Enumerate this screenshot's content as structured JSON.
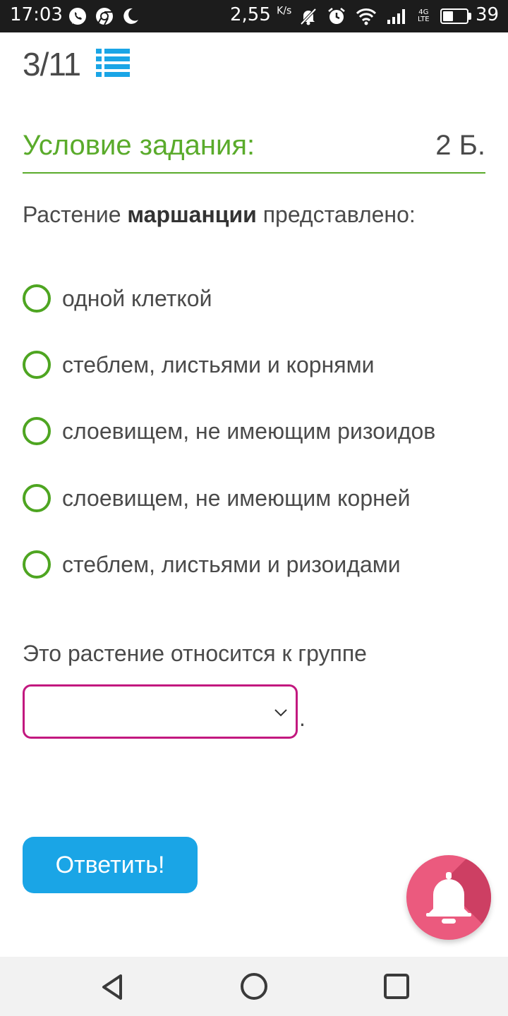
{
  "status_bar": {
    "time": "17:03",
    "speed_value": "2,55",
    "speed_unit": "K/s",
    "network_label_top": "4G",
    "network_label_bottom": "LTE",
    "battery": "39",
    "icons_left": [
      "whatsapp-icon",
      "chrome-icon",
      "moon-icon"
    ],
    "icons_right": [
      "muted-bell-icon",
      "alarm-icon",
      "wifi-icon",
      "signal-icon",
      "battery-icon"
    ]
  },
  "header": {
    "progress": "3/11",
    "list_icon": "list-icon",
    "list_icon_color": "#1aa5e6"
  },
  "condition": {
    "title": "Условие задания:",
    "points": "2 Б.",
    "accent_color": "#5aab2b"
  },
  "question": {
    "prefix": "Растение ",
    "bold": "маршанции",
    "suffix": " представлено:"
  },
  "options": [
    {
      "label": "одной клеткой",
      "selected": false
    },
    {
      "label": "стеблем, листьями и корнями",
      "selected": false
    },
    {
      "label": "слоевищем, не имеющим ризоидов",
      "selected": false
    },
    {
      "label": "слоевищем, не имеющим корней",
      "selected": false
    },
    {
      "label": "стеблем, листьями и ризоидами",
      "selected": false
    }
  ],
  "group_question": {
    "text": "Это растение относится к группе",
    "select_value": "",
    "trailing": ".",
    "select_border_color": "#c2187f"
  },
  "answer_button": {
    "label": "Ответить!",
    "color": "#1aa5e6"
  },
  "notification_button": {
    "icon": "bell-icon",
    "color": "#eb5a7e"
  },
  "nav_bar": {
    "icons": [
      "back-icon",
      "home-icon",
      "recents-icon"
    ]
  }
}
